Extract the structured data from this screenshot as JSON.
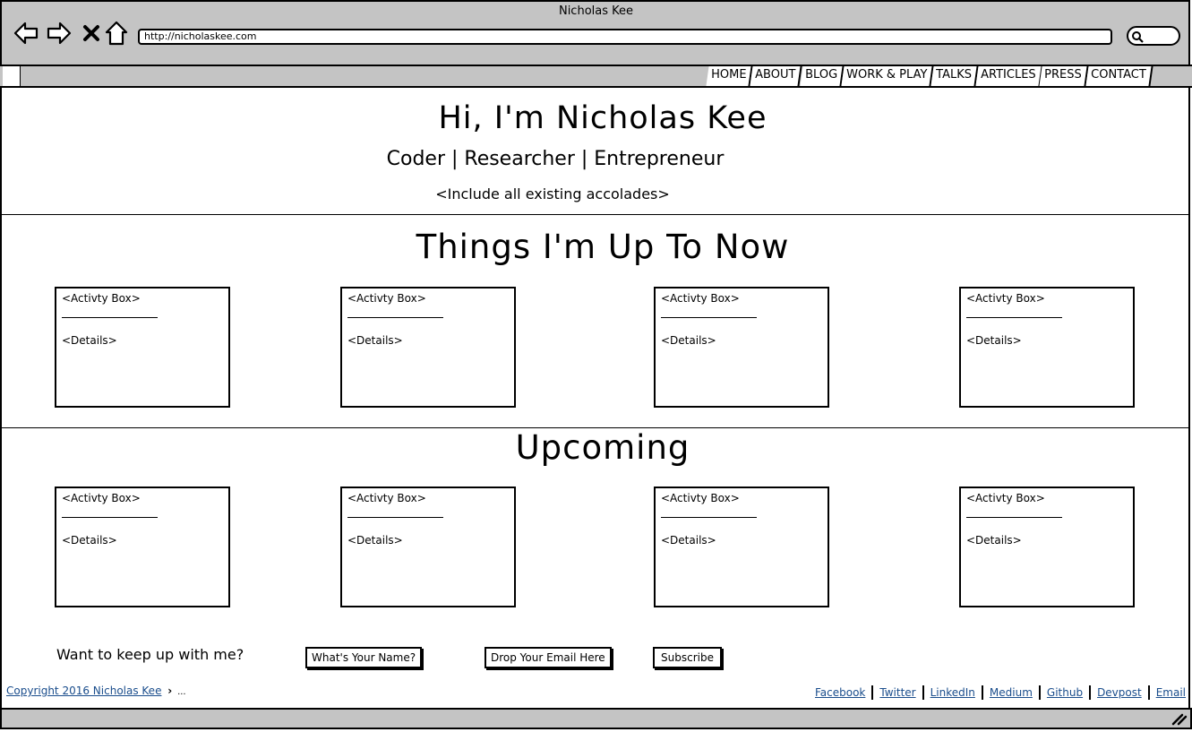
{
  "window": {
    "title": "Nicholas Kee"
  },
  "toolbar": {
    "url": "http://nicholaskee.com",
    "icons": [
      "back-arrow-icon",
      "forward-arrow-icon",
      "close-x-icon",
      "home-icon",
      "search-icon"
    ]
  },
  "nav": {
    "tabs": [
      {
        "label": "HOME"
      },
      {
        "label": "ABOUT"
      },
      {
        "label": "BLOG"
      },
      {
        "label": "WORK & PLAY"
      },
      {
        "label": "TALKS"
      },
      {
        "label": "ARTICLES"
      },
      {
        "label": "PRESS"
      },
      {
        "label": "CONTACT"
      }
    ]
  },
  "hero": {
    "heading": "Hi, I'm Nicholas Kee",
    "roles": "Coder | Researcher | Entrepreneur",
    "accolades": "<Include all existing accolades>"
  },
  "now": {
    "heading": "Things I'm Up To Now",
    "boxes": [
      {
        "title": "<Activty Box>",
        "details": "<Details>"
      },
      {
        "title": "<Activty Box>",
        "details": "<Details>"
      },
      {
        "title": "<Activty Box>",
        "details": "<Details>"
      },
      {
        "title": "<Activty Box>",
        "details": "<Details>"
      }
    ]
  },
  "upcoming": {
    "heading": "Upcoming",
    "boxes": [
      {
        "title": "<Activty Box>",
        "details": "<Details>"
      },
      {
        "title": "<Activty Box>",
        "details": "<Details>"
      },
      {
        "title": "<Activty Box>",
        "details": "<Details>"
      },
      {
        "title": "<Activty Box>",
        "details": "<Details>"
      }
    ]
  },
  "subscribe": {
    "prompt": "Want to keep up with me?",
    "name_field": "What's Your Name?",
    "email_field": "Drop Your Email Here",
    "button": "Subscribe"
  },
  "footer": {
    "copyright": "Copyright 2016 Nicholas Kee",
    "breadcrumb_more": "...",
    "links": [
      "Facebook",
      "Twitter",
      "LinkedIn",
      "Medium",
      "Github",
      "Devpost",
      "Email"
    ]
  }
}
